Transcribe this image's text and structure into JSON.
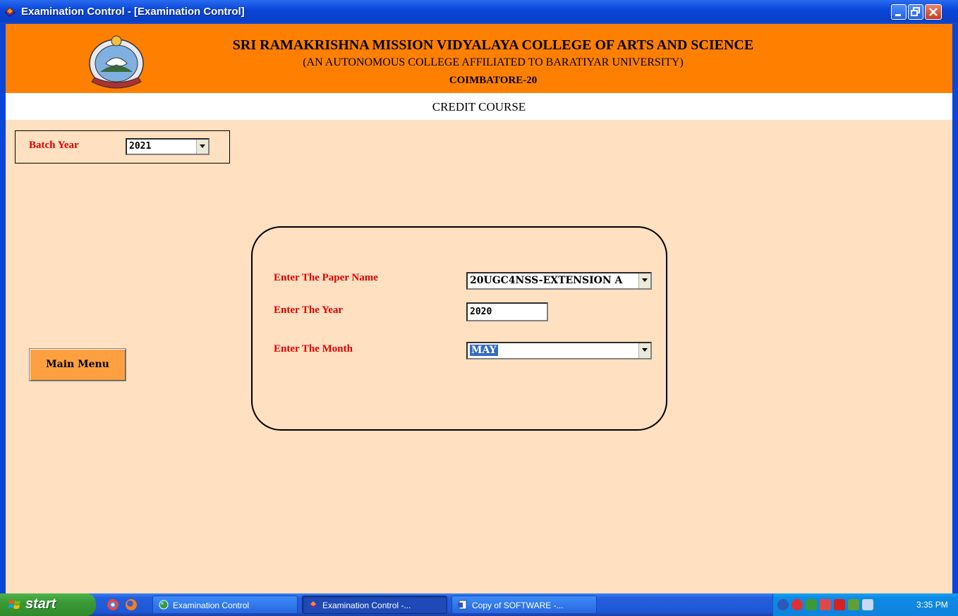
{
  "window": {
    "title": "Examination Control - [Examination Control]",
    "colors": {
      "title_bar": "#0a46d8",
      "header": "#ff8000",
      "background": "#ffe0c0",
      "label_red": "#e00000"
    }
  },
  "header": {
    "line1": "SRI RAMAKRISHNA MISSION VIDYALAYA COLLEGE  OF ARTS AND SCIENCE",
    "line2": "(AN AUTONOMOUS COLLEGE AFFILIATED TO BARATIYAR UNIVERSITY)",
    "line3": "COIMBATORE-20",
    "logo_icon": "college-emblem-icon"
  },
  "page_title": "CREDIT COURSE",
  "batch": {
    "label": "Batch Year",
    "value": "2021"
  },
  "form": {
    "paper_label": "Enter The Paper Name",
    "paper_value": "20UGC4NSS-EXTENSION A",
    "year_label": "Enter The Year",
    "year_value": "2020",
    "month_label": "Enter The Month",
    "month_value": "MAY"
  },
  "main_menu_label": "Main Menu",
  "taskbar": {
    "start_label": "start",
    "tasks": [
      {
        "label": "Examination Control"
      },
      {
        "label": "Examination Control -..."
      },
      {
        "label": "Copy of SOFTWARE -..."
      }
    ],
    "clock": "3:35 PM"
  }
}
